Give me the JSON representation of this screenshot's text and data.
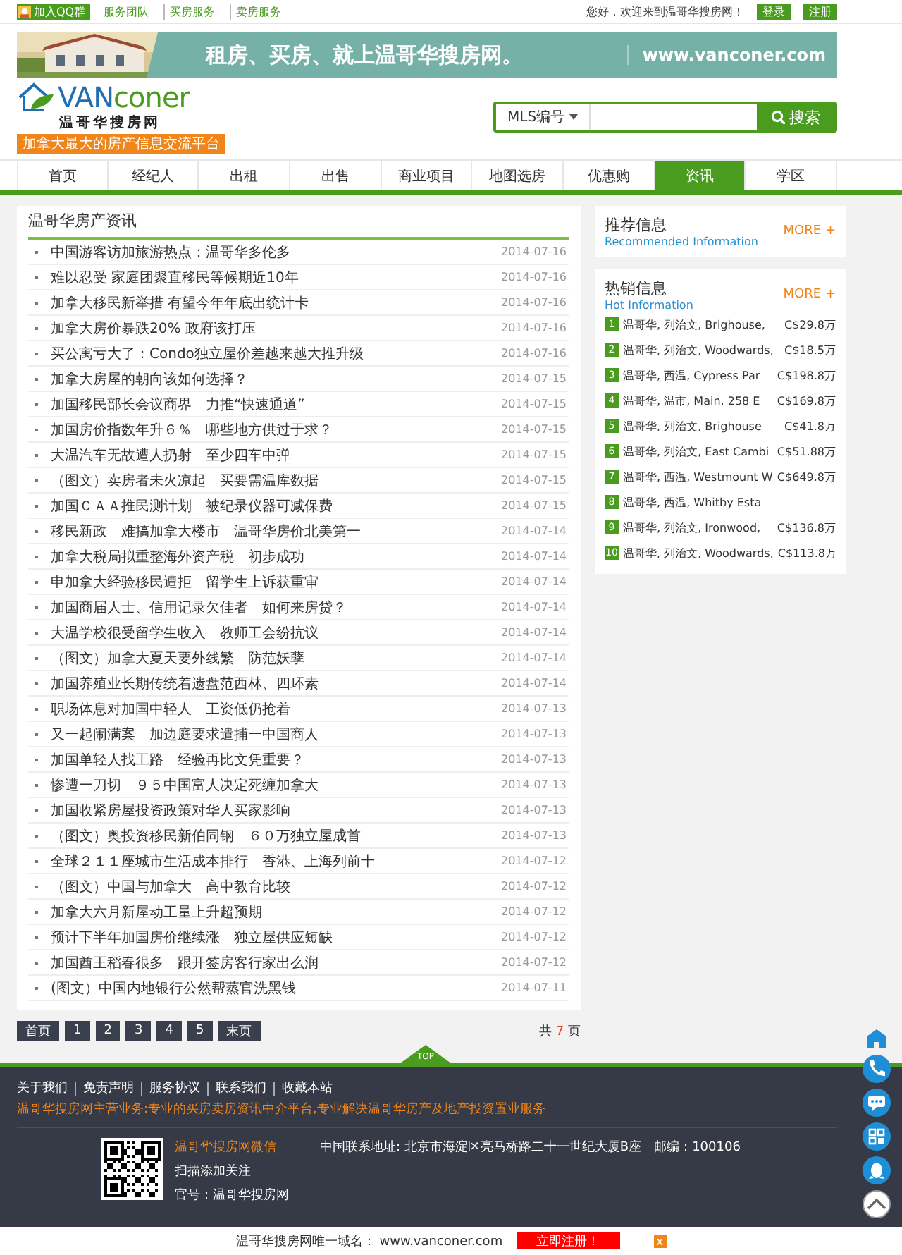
{
  "top_bar": {
    "qq_button": "加入QQ群",
    "links": [
      "服务团队",
      "买房服务",
      "卖房服务"
    ],
    "welcome": "您好，欢迎来到温哥华搜房网！",
    "buttons": [
      "登录",
      "注册"
    ]
  },
  "banner": {
    "slogan": "租房、买房、就上温哥华搜房网。",
    "url": "www.vanconer.com"
  },
  "logo": {
    "wordmark": [
      "VAN",
      "coner"
    ],
    "name": "温哥华搜房网",
    "tagline": "加拿大最大的房产信息交流平台"
  },
  "search": {
    "category": "MLS编号",
    "button": "搜索"
  },
  "nav": [
    {
      "label": "首页",
      "selected": false
    },
    {
      "label": "经纪人",
      "selected": false
    },
    {
      "label": "出租",
      "selected": false
    },
    {
      "label": "出售",
      "selected": false
    },
    {
      "label": "商业项目",
      "selected": false
    },
    {
      "label": "地图选房",
      "selected": false
    },
    {
      "label": "优惠购",
      "selected": false
    },
    {
      "label": "资讯",
      "selected": true
    },
    {
      "label": "学区",
      "selected": false
    }
  ],
  "news": {
    "title": "温哥华房产资讯",
    "items": [
      {
        "title": "中国游客访加旅游热点：温哥华多伦多",
        "date": "2014-07-16"
      },
      {
        "title": "难以忍受 家庭团聚直移民等候期近10年",
        "date": "2014-07-16"
      },
      {
        "title": "加拿大移民新举措 有望今年年底出统计卡",
        "date": "2014-07-16"
      },
      {
        "title": "加拿大房价暴跌20% 政府该打压",
        "date": "2014-07-16"
      },
      {
        "title": "买公寓亏大了：Condo独立屋价差越来越大推升级",
        "date": "2014-07-16"
      },
      {
        "title": "加拿大房屋的朝向该如何选择？",
        "date": "2014-07-15"
      },
      {
        "title": "加国移民部长会议商界　力推“快速通道”",
        "date": "2014-07-15"
      },
      {
        "title": "加国房价指数年升６％　哪些地方供过于求？",
        "date": "2014-07-15"
      },
      {
        "title": "大温汽车无故遭人扔射　至少四车中弹",
        "date": "2014-07-15"
      },
      {
        "title": "（图文）卖房者未火凉起　买要需温库数据",
        "date": "2014-07-15"
      },
      {
        "title": "加国ＣＡＡ推民测计划　被纪录仪器可减保费",
        "date": "2014-07-15"
      },
      {
        "title": "移民新政　难搞加拿大楼市　温哥华房价北美第一",
        "date": "2014-07-14"
      },
      {
        "title": "加拿大税局拟重整海外资产税　初步成功",
        "date": "2014-07-14"
      },
      {
        "title": "申加拿大经验移民遭拒　留学生上诉获重审",
        "date": "2014-07-14"
      },
      {
        "title": "加国商届人士、信用记录欠佳者　如何来房贷？",
        "date": "2014-07-14"
      },
      {
        "title": "大温学校很受留学生收入　教师工会纷抗议",
        "date": "2014-07-14"
      },
      {
        "title": "（图文）加拿大夏天要外线繁　防范妖孽",
        "date": "2014-07-14"
      },
      {
        "title": "加国养殖业长期传统着遗盘范西林、四环素",
        "date": "2014-07-14"
      },
      {
        "title": "职场体息对加国中轻人　工资低仍抢着",
        "date": "2014-07-13"
      },
      {
        "title": "又一起闹满案　加边庭要求遣捕一中国商人",
        "date": "2014-07-13"
      },
      {
        "title": "加国单轻人找工路　经验再比文凭重要？",
        "date": "2014-07-13"
      },
      {
        "title": "惨遭一刀切　９５中国富人决定死缠加拿大",
        "date": "2014-07-13"
      },
      {
        "title": "加国收紧房屋投资政策对华人买家影响",
        "date": "2014-07-13"
      },
      {
        "title": "（图文）奥投资移民新伯同钢　６０万独立屋成首",
        "date": "2014-07-13"
      },
      {
        "title": "全球２１１座城市生活成本排行　香港、上海列前十",
        "date": "2014-07-12"
      },
      {
        "title": "（图文）中国与加拿大　高中教育比较",
        "date": "2014-07-12"
      },
      {
        "title": "加拿大六月新屋动工量上升超预期",
        "date": "2014-07-12"
      },
      {
        "title": "预计下半年加国房价继续涨　独立屋供应短缺",
        "date": "2014-07-12"
      },
      {
        "title": "加国酋王稻春很多　跟开签房客行家出么润",
        "date": "2014-07-12"
      },
      {
        "title": "(图文）中国内地银行公然帮蒸官洗黑钱",
        "date": "2014-07-11"
      }
    ]
  },
  "pagination": {
    "pages": [
      "首页",
      "1",
      "2",
      "3",
      "4",
      "5",
      "末页"
    ],
    "total_prefix": "共",
    "total": "7",
    "total_suffix": "页"
  },
  "recommended": {
    "title": "推荐信息",
    "subtitle": "Recommended Information",
    "more": "MORE +"
  },
  "hot": {
    "title": "热销信息",
    "subtitle": "Hot Information",
    "more": "MORE +",
    "items": [
      {
        "rank": "1",
        "title": "温哥华, 列治文, Brighouse,",
        "price": "C$29.8万"
      },
      {
        "rank": "2",
        "title": "温哥华, 列治文, Woodwards,",
        "price": "C$18.5万"
      },
      {
        "rank": "3",
        "title": "温哥华, 西温, Cypress Par",
        "price": "C$198.8万"
      },
      {
        "rank": "4",
        "title": "温哥华, 温市, Main, 258 E",
        "price": "C$169.8万"
      },
      {
        "rank": "5",
        "title": "温哥华, 列治文, Brighouse",
        "price": "C$41.8万"
      },
      {
        "rank": "6",
        "title": "温哥华, 列治文, East Cambi",
        "price": "C$51.88万"
      },
      {
        "rank": "7",
        "title": "温哥华, 西温, Westmount W",
        "price": "C$649.8万"
      },
      {
        "rank": "8",
        "title": "温哥华, 西温, Whitby Esta"
      },
      {
        "rank": "9",
        "title": "温哥华, 列治文, Ironwood,",
        "price": "C$136.8万"
      },
      {
        "rank": "10",
        "title": "温哥华, 列治文, Woodwards,",
        "price": "C$113.8万"
      }
    ]
  },
  "footer": {
    "top_tab": "TOP",
    "links": [
      "关于我们",
      "免责声明",
      "服务协议",
      "联系我们",
      "收藏本站"
    ],
    "business": "温哥华搜房网主营业务:专业的买房卖房资讯中介平台,专业解决温哥华房产及地产投资置业服务",
    "wechat_title": "温哥华搜房网微信",
    "wechat_hint": "扫描添加关注",
    "wechat_id": "官号：温哥华搜房网",
    "address": "中国联系地址: 北京市海淀区亮马桥路二十一世纪大厦B座　邮编：100106"
  },
  "bottom_bar": {
    "domain_note": "温哥华搜房网唯一域名： www.vanconer.com",
    "register": "立即注册！",
    "close": "x"
  }
}
